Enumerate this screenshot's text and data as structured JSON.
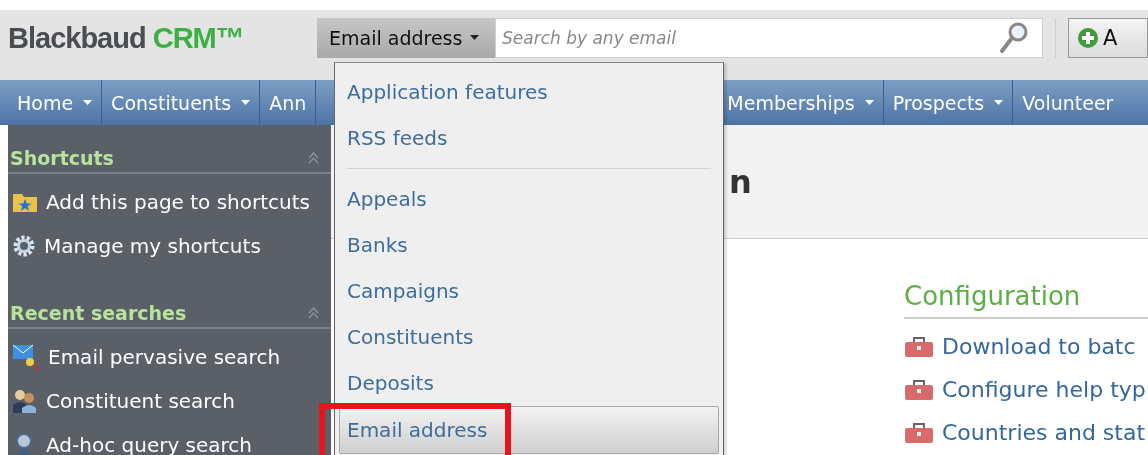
{
  "header": {
    "logo": {
      "brand": "Blackbaud",
      "product": "CRM™"
    },
    "search": {
      "scope": "Email address",
      "placeholder": "Search by any email"
    },
    "add_button": "A"
  },
  "nav": [
    {
      "label": "Home",
      "caret": true
    },
    {
      "label": "Constituents",
      "caret": true
    },
    {
      "label": "Ann",
      "caret": false
    },
    {
      "label": "Memberships",
      "caret": true
    },
    {
      "label": "Prospects",
      "caret": true
    },
    {
      "label": "Volunteer",
      "caret": false
    }
  ],
  "sidebar": [
    {
      "title": "Shortcuts",
      "items": [
        {
          "label": "Add this page to shortcuts",
          "kind": "folder"
        },
        {
          "label": "Manage my shortcuts",
          "kind": "gear"
        }
      ]
    },
    {
      "title": "Recent searches",
      "items": [
        {
          "label": "Email pervasive search",
          "kind": "envelope"
        },
        {
          "label": "Constituent search",
          "kind": "people"
        },
        {
          "label": "Ad-hoc query search",
          "kind": "query"
        }
      ]
    }
  ],
  "main": {
    "heading": "n",
    "configuration": {
      "title": "Configuration",
      "links": [
        "Download to batc",
        "Configure help typ",
        "Countries and stat"
      ]
    }
  },
  "dropdown": {
    "groups": [
      [
        {
          "label": "Application features",
          "selected": false
        },
        {
          "label": "RSS feeds",
          "selected": false
        }
      ],
      [
        {
          "label": "Appeals",
          "selected": false
        },
        {
          "label": "Banks",
          "selected": false
        },
        {
          "label": "Campaigns",
          "selected": false
        },
        {
          "label": "Constituents",
          "selected": false
        },
        {
          "label": "Deposits",
          "selected": false
        },
        {
          "label": "Email address",
          "selected": true
        }
      ]
    ]
  }
}
